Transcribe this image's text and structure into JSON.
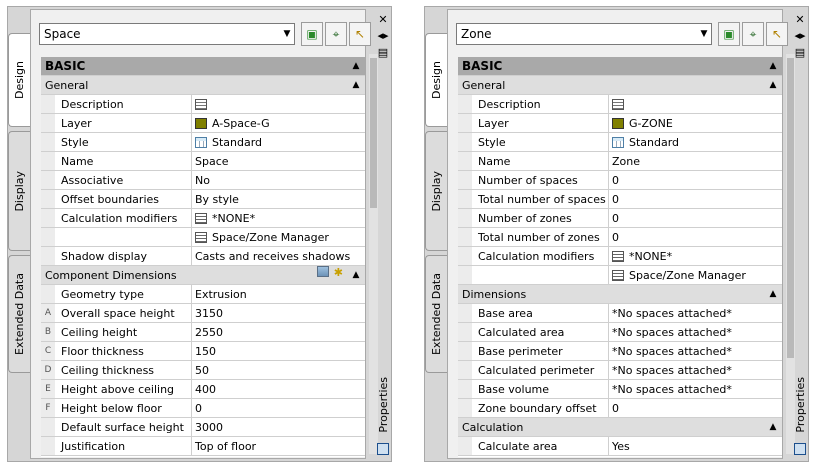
{
  "palettes": [
    {
      "tabs": [
        "Design",
        "Display",
        "Extended Data"
      ],
      "selector": "Space",
      "side_label": "Properties",
      "rows": [
        {
          "kind": "sec",
          "label": "BASIC",
          "toggle": "▲"
        },
        {
          "kind": "cat",
          "label": "General",
          "toggle": "▲"
        },
        {
          "kind": "prop",
          "label": "Description",
          "icon": "doc",
          "value": ""
        },
        {
          "kind": "prop",
          "label": "Layer",
          "icon": "olive",
          "value": "A-Space-G"
        },
        {
          "kind": "prop",
          "label": "Style",
          "icon": "grid",
          "value": "Standard"
        },
        {
          "kind": "prop",
          "label": "Name",
          "value": "Space"
        },
        {
          "kind": "prop",
          "label": "Associative",
          "value": "No"
        },
        {
          "kind": "prop",
          "label": "Offset boundaries",
          "value": "By style"
        },
        {
          "kind": "prop",
          "label": "Calculation modifiers",
          "icon": "list",
          "value": "*NONE*"
        },
        {
          "kind": "prop",
          "label": "",
          "icon": "list",
          "value": "Space/Zone Manager"
        },
        {
          "kind": "prop",
          "label": "Shadow display",
          "value": "Casts and receives shadows"
        },
        {
          "kind": "cat",
          "label": "Component Dimensions",
          "toggle": "▲",
          "extra": "img"
        },
        {
          "kind": "prop",
          "label": "Geometry type",
          "value": "Extrusion"
        },
        {
          "kind": "prop",
          "tag": "A",
          "label": "Overall space height",
          "value": "3150"
        },
        {
          "kind": "prop",
          "tag": "B",
          "label": "Ceiling height",
          "value": "2550"
        },
        {
          "kind": "prop",
          "tag": "C",
          "label": "Floor thickness",
          "value": "150"
        },
        {
          "kind": "prop",
          "tag": "D",
          "label": "Ceiling thickness",
          "value": "50"
        },
        {
          "kind": "prop",
          "tag": "E",
          "label": "Height above ceiling",
          "value": "400"
        },
        {
          "kind": "prop",
          "tag": "F",
          "label": "Height below floor",
          "value": "0"
        },
        {
          "kind": "prop",
          "label": "Default surface height",
          "value": "3000"
        },
        {
          "kind": "prop",
          "label": "Justification",
          "value": "Top of floor"
        }
      ]
    },
    {
      "tabs": [
        "Design",
        "Display",
        "Extended Data"
      ],
      "selector": "Zone",
      "side_label": "Properties",
      "rows": [
        {
          "kind": "sec",
          "label": "BASIC",
          "toggle": "▲"
        },
        {
          "kind": "cat",
          "label": "General",
          "toggle": "▲"
        },
        {
          "kind": "prop",
          "label": "Description",
          "icon": "doc",
          "value": ""
        },
        {
          "kind": "prop",
          "label": "Layer",
          "icon": "olive",
          "value": "G-ZONE"
        },
        {
          "kind": "prop",
          "label": "Style",
          "icon": "grid",
          "value": "Standard"
        },
        {
          "kind": "prop",
          "label": "Name",
          "value": "Zone"
        },
        {
          "kind": "prop",
          "label": "Number of spaces",
          "value": "0"
        },
        {
          "kind": "prop",
          "label": "Total number of spaces",
          "value": "0"
        },
        {
          "kind": "prop",
          "label": "Number of zones",
          "value": "0"
        },
        {
          "kind": "prop",
          "label": "Total number of zones",
          "value": "0"
        },
        {
          "kind": "prop",
          "label": "Calculation modifiers",
          "icon": "list",
          "value": "*NONE*"
        },
        {
          "kind": "prop",
          "label": "",
          "icon": "list",
          "value": "Space/Zone Manager"
        },
        {
          "kind": "cat",
          "label": "Dimensions",
          "toggle": "▲"
        },
        {
          "kind": "prop",
          "label": "Base area",
          "value": "*No spaces attached*"
        },
        {
          "kind": "prop",
          "label": "Calculated area",
          "value": "*No spaces attached*"
        },
        {
          "kind": "prop",
          "label": "Base perimeter",
          "value": "*No spaces attached*"
        },
        {
          "kind": "prop",
          "label": "Calculated perimeter",
          "value": "*No spaces attached*"
        },
        {
          "kind": "prop",
          "label": "Base volume",
          "value": "*No spaces attached*"
        },
        {
          "kind": "prop",
          "label": "Zone boundary offset",
          "value": "0"
        },
        {
          "kind": "cat",
          "label": "Calculation",
          "toggle": "▲"
        },
        {
          "kind": "prop",
          "label": "Calculate area",
          "value": "Yes"
        }
      ]
    }
  ]
}
